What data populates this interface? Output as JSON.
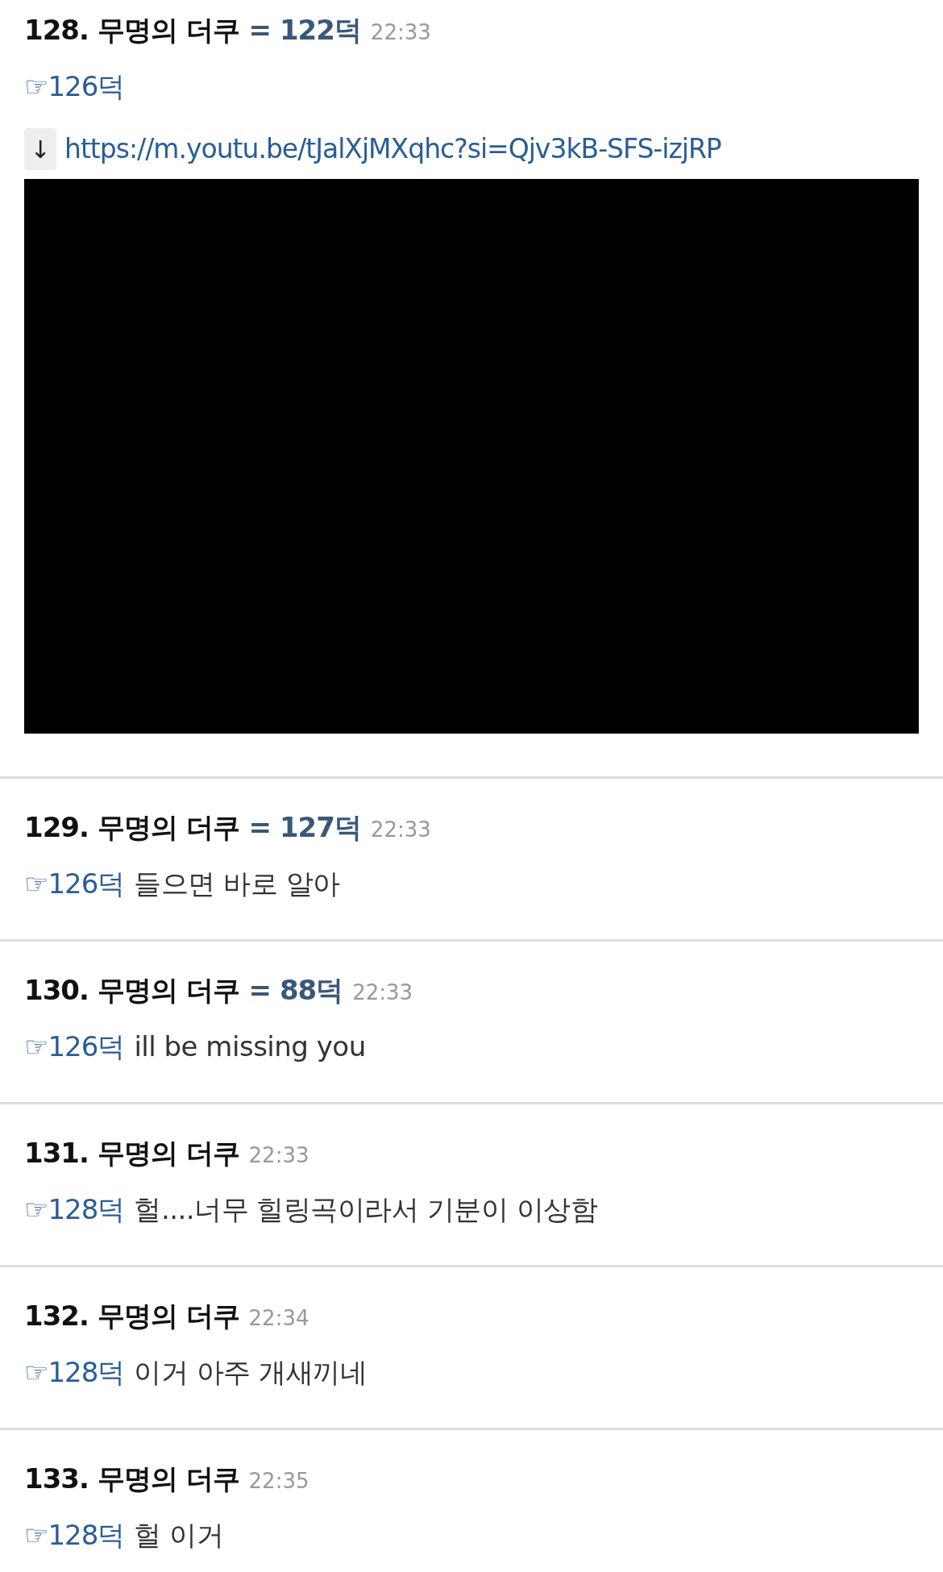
{
  "posts": [
    {
      "number": "128.",
      "author": "무명의 더쿠",
      "reference": "= 122덕",
      "time": "22:33",
      "reply_link": "☞126덕",
      "attachment": {
        "kind": "video",
        "download_icon": "↓",
        "url": "https://m.youtu.be/tJalXjMXqhc?si=Qjv3kB-SFS-izjRP"
      }
    },
    {
      "number": "129.",
      "author": "무명의 더쿠",
      "reference": "= 127덕",
      "time": "22:33",
      "reply_link": "☞126덕",
      "text": "들으면 바로 알아"
    },
    {
      "number": "130.",
      "author": "무명의 더쿠",
      "reference": "= 88덕",
      "time": "22:33",
      "reply_link": "☞126덕",
      "text": "ill be missing you"
    },
    {
      "number": "131.",
      "author": "무명의 더쿠",
      "time": "22:33",
      "reply_link": "☞128덕",
      "text": "헐....너무 힐링곡이라서 기분이 이상함"
    },
    {
      "number": "132.",
      "author": "무명의 더쿠",
      "time": "22:34",
      "reply_link": "☞128덕",
      "text": "이거 아주 개새끼네"
    },
    {
      "number": "133.",
      "author": "무명의 더쿠",
      "time": "22:35",
      "reply_link": "☞128덕",
      "text": "헐 이거"
    }
  ]
}
